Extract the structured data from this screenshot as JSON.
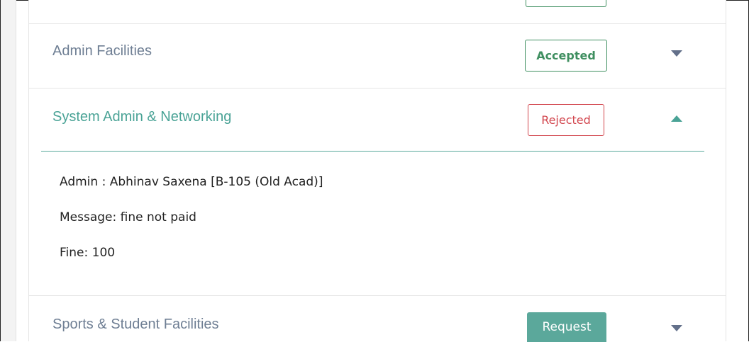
{
  "facilities": [
    {
      "title": "Admin Facilities",
      "status": "Accepted",
      "status_type": "accepted",
      "expanded": false,
      "toggle_icon": "caret-down-icon"
    },
    {
      "title": "System Admin & Networking",
      "status": "Rejected",
      "status_type": "rejected",
      "expanded": true,
      "toggle_icon": "caret-up-icon",
      "details": {
        "admin": "Admin : Abhinav Saxena [B-105 (Old Acad)]",
        "message": "Message: fine not paid",
        "fine": "Fine: 100"
      }
    },
    {
      "title": "Sports & Student Facilities",
      "status": "Request",
      "status_type": "request",
      "expanded": false,
      "toggle_icon": "caret-down-icon"
    }
  ],
  "colors": {
    "accepted": "#3f8f60",
    "rejected": "#d2454d",
    "request": "#5ba89b",
    "active_title": "#4aa396",
    "title": "#6f7f94"
  }
}
